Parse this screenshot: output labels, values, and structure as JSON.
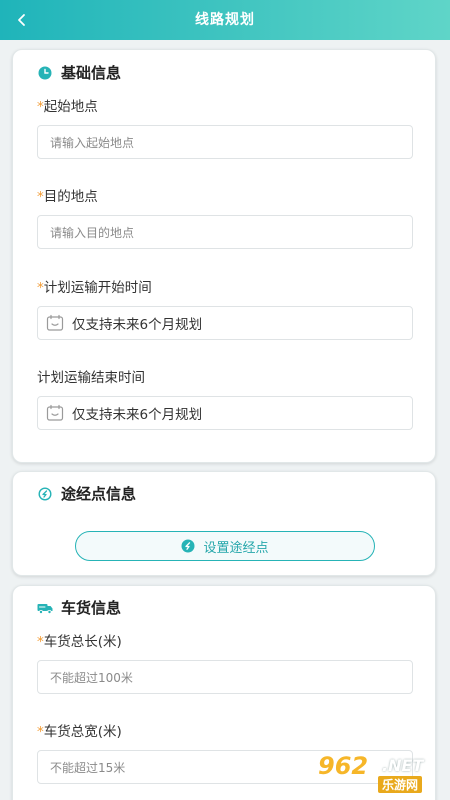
{
  "header": {
    "title": "线路规划"
  },
  "basic_info": {
    "title": "基础信息",
    "required_mark": "*",
    "start_label": "起始地点",
    "start_placeholder": "请输入起始地点",
    "dest_label": "目的地点",
    "dest_placeholder": "请输入目的地点",
    "plan_start_label": "计划运输开始时间",
    "plan_start_value": "仅支持未来6个月规划",
    "plan_end_label": "计划运输结束时间",
    "plan_end_value": "仅支持未来6个月规划"
  },
  "waypoint_info": {
    "title": "途经点信息",
    "button_label": "设置途经点"
  },
  "cargo_info": {
    "title": "车货信息",
    "length_label": "车货总长(米)",
    "length_placeholder": "不能超过100米",
    "width_label": "车货总宽(米)",
    "width_placeholder": "不能超过15米"
  },
  "watermark": {
    "number": "962",
    "suffix": ".NET",
    "site": "乐游网"
  },
  "colors": {
    "header_start": "#1fb4ba",
    "header_end": "#5fd5c8",
    "accent": "#26b3b6",
    "required": "#f29a32",
    "page_bg": "#eef2f3"
  },
  "icons": {
    "back": "chevron-left-icon",
    "basic": "clock-icon",
    "waypoint": "waypoint-icon",
    "cargo": "truck-icon",
    "calendar": "calendar-icon"
  }
}
